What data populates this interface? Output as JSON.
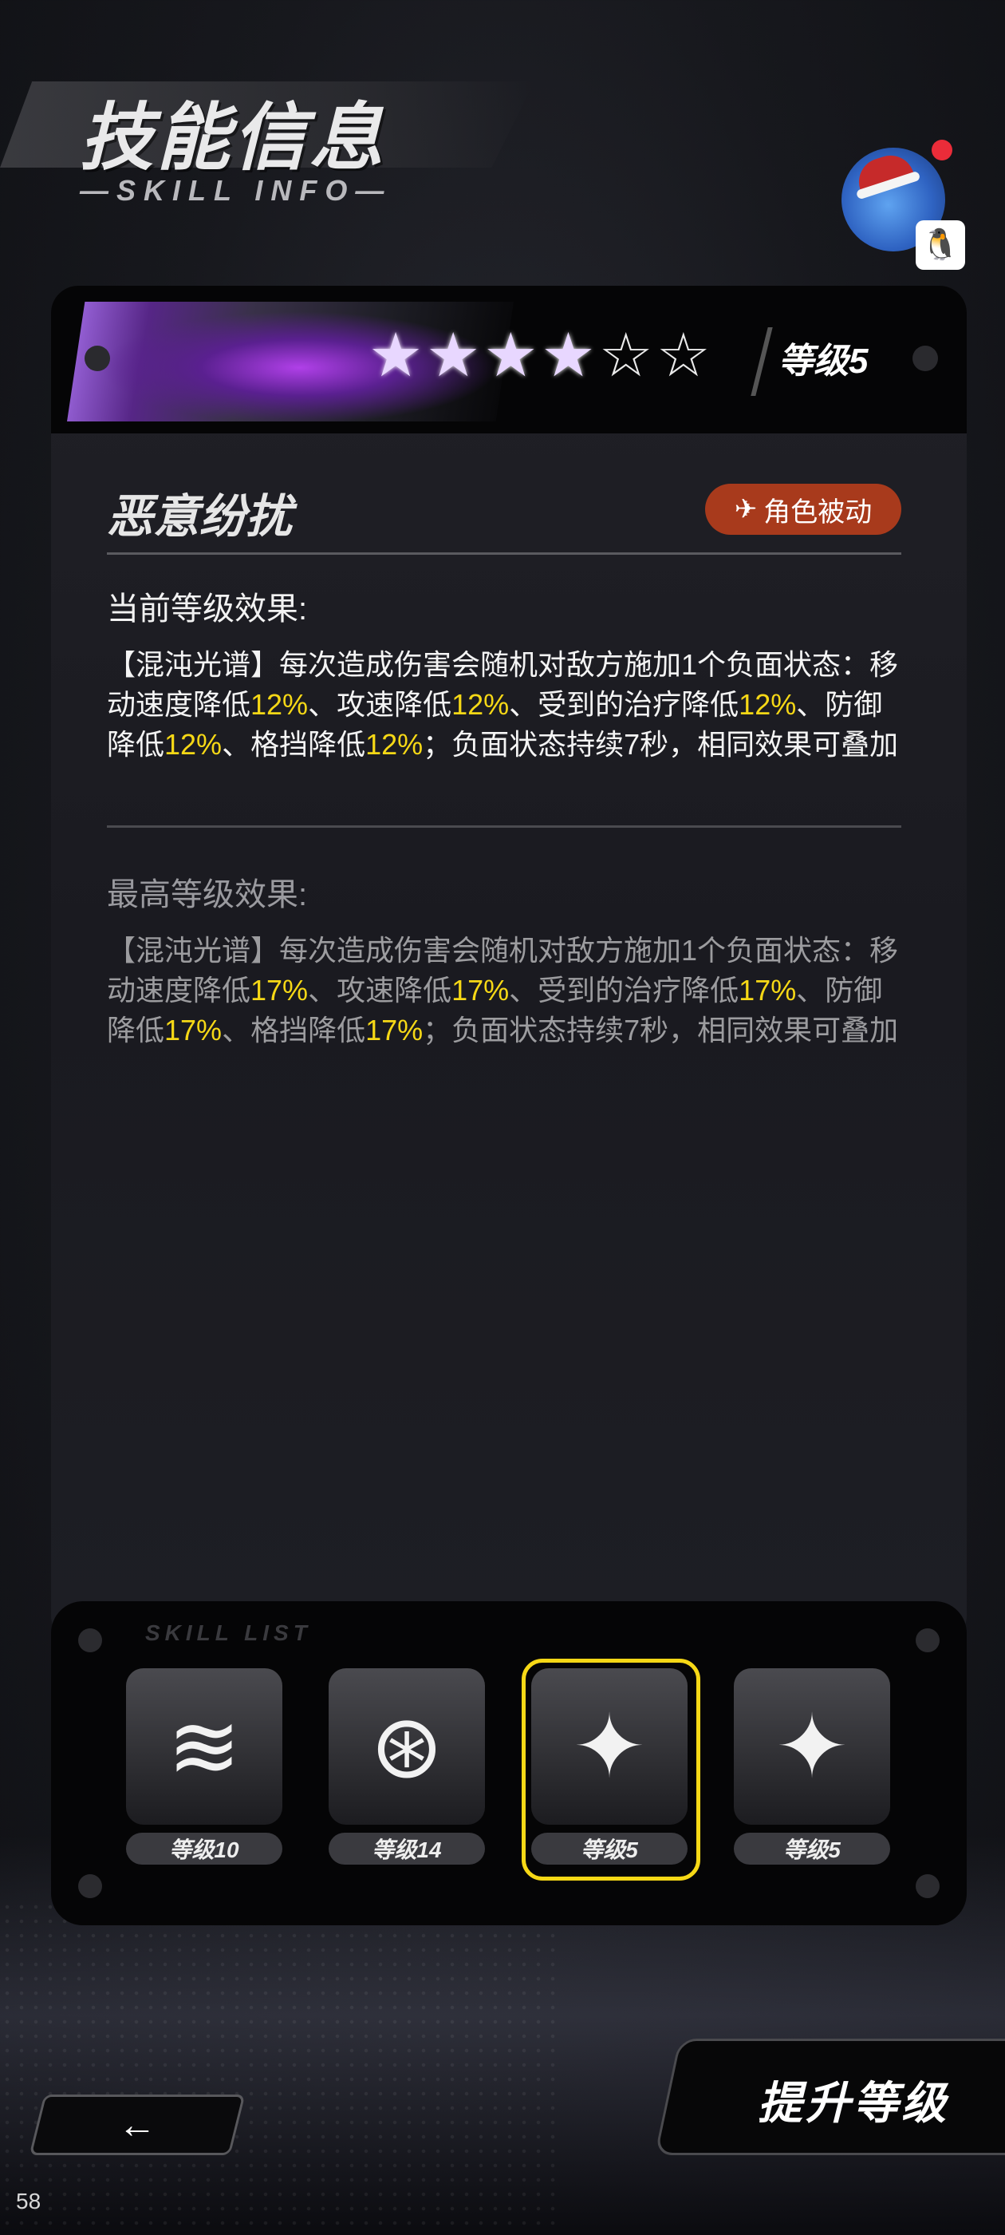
{
  "header": {
    "title": "技能信息",
    "subtitle": "—SKILL INFO—"
  },
  "skill": {
    "stars": [
      1,
      1,
      1,
      1,
      0,
      0
    ],
    "level_label": "等级5",
    "name": "恶意纷扰",
    "tag": "角色被动",
    "current_title": "当前等级效果:",
    "current_desc": [
      {
        "t": "【混沌光谱】每次造成伤害会随机对敌方施加1个负面状态：移动速度降低"
      },
      {
        "t": "12%",
        "hl": true
      },
      {
        "t": "、攻速降低"
      },
      {
        "t": "12%",
        "hl": true
      },
      {
        "t": "、受到的治疗降低"
      },
      {
        "t": "12%",
        "hl": true
      },
      {
        "t": "、防御降低"
      },
      {
        "t": "12%",
        "hl": true
      },
      {
        "t": "、格挡降低"
      },
      {
        "t": "12%",
        "hl": true
      },
      {
        "t": "；负面状态持续7秒，相同效果可叠加"
      }
    ],
    "max_title": "最高等级效果:",
    "max_desc": [
      {
        "t": "【混沌光谱】每次造成伤害会随机对敌方施加1个负面状态：移动速度降低"
      },
      {
        "t": "17%",
        "hl": true
      },
      {
        "t": "、攻速降低"
      },
      {
        "t": "17%",
        "hl": true
      },
      {
        "t": "、受到的治疗降低"
      },
      {
        "t": "17%",
        "hl": true
      },
      {
        "t": "、防御降低"
      },
      {
        "t": "17%",
        "hl": true
      },
      {
        "t": "、格挡降低"
      },
      {
        "t": "17%",
        "hl": true
      },
      {
        "t": "；负面状态持续7秒，相同效果可叠加"
      }
    ]
  },
  "skill_list": {
    "title": "SKILL LIST",
    "items": [
      {
        "label": "等级10",
        "icon": "blade-burst-icon",
        "selected": false
      },
      {
        "label": "等级14",
        "icon": "spinning-orb-icon",
        "selected": false
      },
      {
        "label": "等级5",
        "icon": "crosshair-star-icon",
        "selected": true
      },
      {
        "label": "等级5",
        "icon": "crosshair-star-icon",
        "selected": false
      }
    ]
  },
  "buttons": {
    "back_icon": "←",
    "upgrade_label": "提升等级"
  },
  "page_number": "58",
  "colors": {
    "highlight": "#f6d816",
    "tag_bg": "#a83a1c",
    "selected_border": "#f6d816"
  }
}
